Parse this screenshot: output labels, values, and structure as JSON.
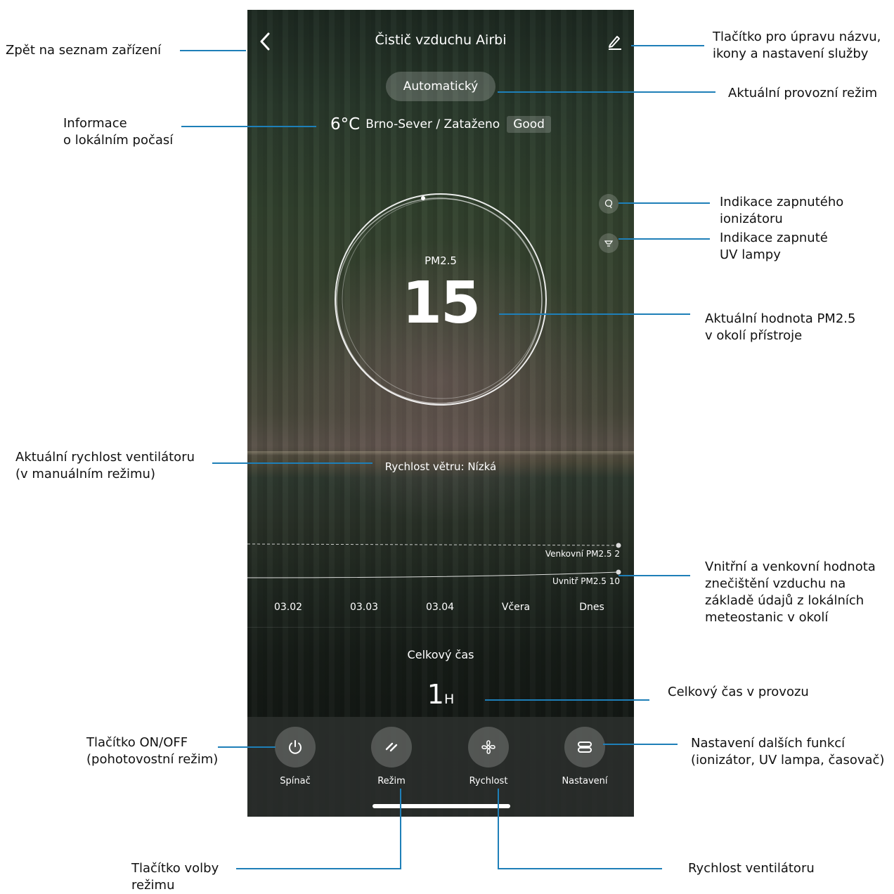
{
  "phone": {
    "title": "Čistič vzduchu Airbi",
    "mode": "Automatický",
    "weather": {
      "temp": "6°C",
      "location": "Brno-Sever / Zataženo",
      "air_quality": "Good"
    },
    "pm_label": "PM2.5",
    "pm_value": "15",
    "fan_speed_text": "Rychlost větru: Nízká",
    "chart": {
      "outdoor_label": "Venkovní PM2.5 2",
      "indoor_label": "Uvnitř PM2.5 10",
      "dates": [
        "03.02",
        "03.03",
        "03.04",
        "Včera",
        "Dnes"
      ]
    },
    "total_time_label": "Celkový čas",
    "total_time_value": "1",
    "total_time_unit": "H",
    "buttons": [
      {
        "label": "Spínač",
        "icon": "power-icon"
      },
      {
        "label": "Režim",
        "icon": "mode-icon"
      },
      {
        "label": "Rychlost",
        "icon": "fan-icon"
      },
      {
        "label": "Nastavení",
        "icon": "settings-icon"
      }
    ],
    "side_indicators": [
      "ionizer-icon",
      "uv-lamp-icon"
    ],
    "accent_line_color": "#1e7fb8"
  },
  "annotations": {
    "back": "Zpět na seznam zařízení",
    "edit_1": "Tlačítko pro úpravu názvu,",
    "edit_2": "ikony a nastavení služby",
    "mode": "Aktuální provozní režim",
    "weather_1": "Informace",
    "weather_2": "o lokálním počasí",
    "ionizer_1": "Indikace zapnutého",
    "ionizer_2": "ionizátoru",
    "uv_1": "Indikace zapnuté",
    "uv_2": "UV lampy",
    "pm_1": "Aktuální hodnota PM2.5",
    "pm_2": "v okolí přístroje",
    "fan_1": "Aktuální rychlost ventilátoru",
    "fan_2": "(v manuálním režimu)",
    "chart_1": "Vnitřní a venkovní hodnota",
    "chart_2": "znečištění vzduchu na",
    "chart_3": "základě údajů z lokálních",
    "chart_4": "meteostanic v okolí",
    "total": "Celkový čas v provozu",
    "onoff_1": "Tlačítko ON/OFF",
    "onoff_2": "(pohotovostní režim)",
    "settings_1": "Nastavení dalších funkcí",
    "settings_2": "(ionizátor, UV lampa, časovač)",
    "mode_btn_1": "Tlačítko volby",
    "mode_btn_2": "režimu",
    "speed": "Rychlost ventilátoru"
  }
}
